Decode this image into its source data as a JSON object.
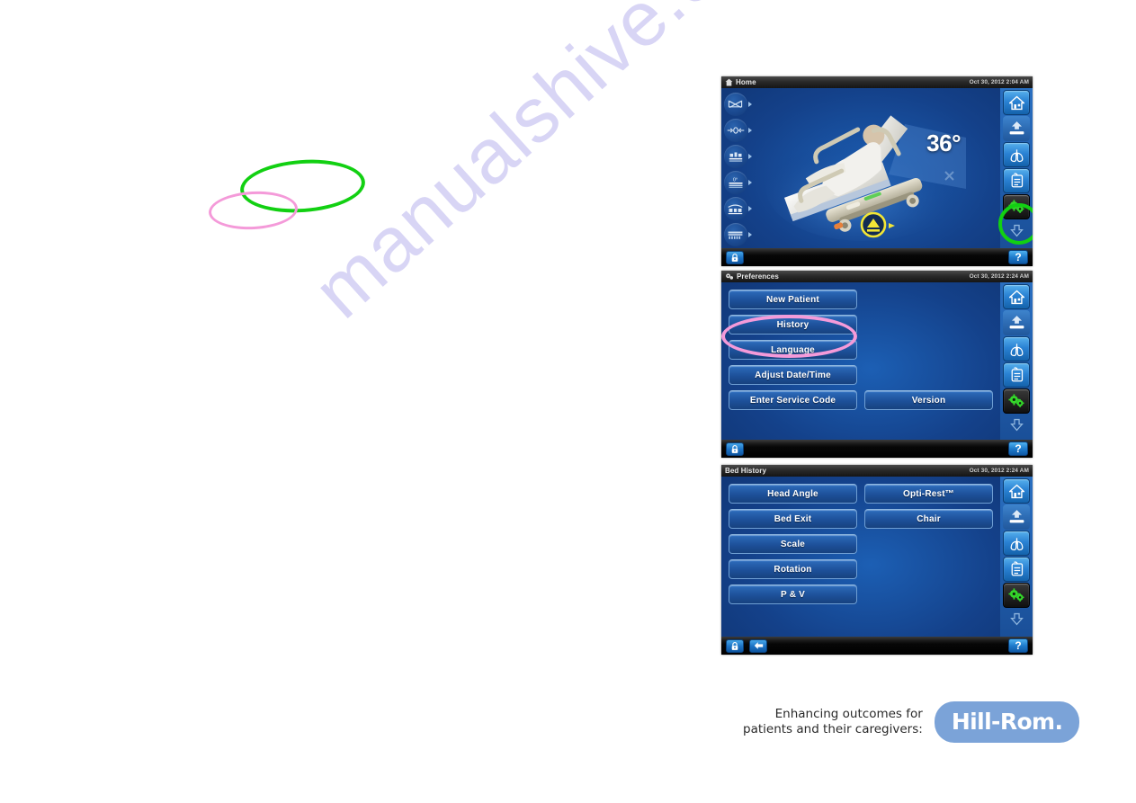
{
  "watermark": {
    "text": "manualshive.com"
  },
  "annotations": {
    "green_ellipse_label": "green-highlight-ellipse",
    "pink_ellipse_label": "pink-highlight-ellipse"
  },
  "panels": [
    {
      "id": "home",
      "title": "Home",
      "title_icon": "home-icon",
      "datetime": "Oct 30, 2012 2:04 AM",
      "angle_readout": "36°",
      "left_rail": [
        {
          "icon": "bed-exit-icon"
        },
        {
          "icon": "scale-zero-icon"
        },
        {
          "icon": "bed-position-icon"
        },
        {
          "icon": "bed-angle-zero-icon"
        },
        {
          "icon": "bed-surface-icon"
        },
        {
          "icon": "mattress-therapy-icon"
        }
      ],
      "bed_graphic": {
        "name": "hospital-bed-illustration",
        "head_angle": "36°",
        "eject_icon": "eject-warning-icon"
      },
      "right_rail": [
        {
          "icon": "home-icon",
          "state": "selected"
        },
        {
          "icon": "bed-up-icon",
          "state": "normal"
        },
        {
          "icon": "lungs-icon",
          "state": "normal"
        },
        {
          "icon": "chart-clipboard-icon",
          "state": "normal"
        },
        {
          "icon": "gears-icon",
          "state": "dark",
          "highlighted": true
        },
        {
          "icon": "scroll-down-arrow-icon",
          "state": "ghost"
        }
      ],
      "bottombar": {
        "lock_icon": "lock-icon",
        "back_icon": null,
        "help_label": "?"
      }
    },
    {
      "id": "prefs",
      "title": "Preferences",
      "title_icon": "gears-icon",
      "datetime": "Oct 30, 2012 2:24 AM",
      "left_buttons": [
        "New Patient",
        "History",
        "Language",
        "Adjust Date/Time",
        "Enter Service Code"
      ],
      "right_buttons": [
        "Version"
      ],
      "highlighted_button": "History",
      "right_rail": [
        {
          "icon": "home-icon",
          "state": "selected"
        },
        {
          "icon": "bed-up-icon",
          "state": "normal"
        },
        {
          "icon": "lungs-icon",
          "state": "normal"
        },
        {
          "icon": "chart-clipboard-icon",
          "state": "normal"
        },
        {
          "icon": "gears-icon",
          "state": "dark",
          "highlighted": false
        },
        {
          "icon": "scroll-down-arrow-icon",
          "state": "ghost"
        }
      ],
      "bottombar": {
        "lock_icon": "lock-icon",
        "back_icon": null,
        "help_label": "?"
      }
    },
    {
      "id": "history",
      "title": "Bed History",
      "title_icon": null,
      "datetime": "Oct 30, 2012 2:24 AM",
      "left_buttons": [
        "Head Angle",
        "Bed Exit",
        "Scale",
        "Rotation",
        "P & V"
      ],
      "right_buttons": [
        "Opti-Rest™",
        "Chair"
      ],
      "right_rail": [
        {
          "icon": "home-icon",
          "state": "selected"
        },
        {
          "icon": "bed-up-icon",
          "state": "normal"
        },
        {
          "icon": "lungs-icon",
          "state": "normal"
        },
        {
          "icon": "chart-clipboard-icon",
          "state": "normal"
        },
        {
          "icon": "gears-icon",
          "state": "dark",
          "highlighted": false
        },
        {
          "icon": "scroll-down-arrow-icon",
          "state": "ghost"
        }
      ],
      "bottombar": {
        "lock_icon": "lock-icon",
        "back_icon": "back-arrow-icon",
        "help_label": "?"
      }
    }
  ],
  "footer": {
    "tagline_line1": "Enhancing outcomes for",
    "tagline_line2": "patients and their caregivers:",
    "brand": "Hill-Rom."
  },
  "colors": {
    "screen_blue": "#164a94",
    "button_blue": "#2a66b4",
    "highlight_green": "#12d012",
    "highlight_pink": "#f49ad9",
    "brand_pill": "#7ba3d8",
    "watermark": "#d8d5f5"
  }
}
